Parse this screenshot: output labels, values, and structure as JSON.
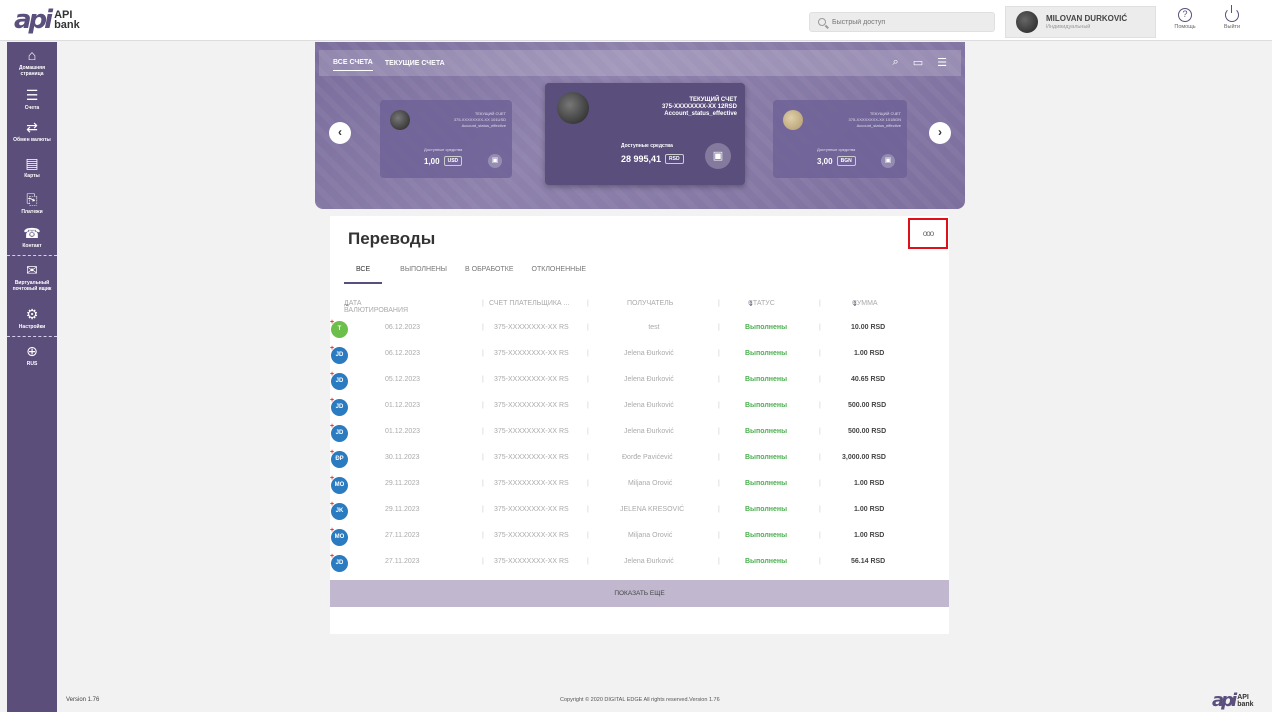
{
  "brand": {
    "mark": "api",
    "line1": "API",
    "line2": "bank"
  },
  "search": {
    "placeholder": "Быстрый доступ"
  },
  "user": {
    "name": "MILOVAN DURKOVIĆ",
    "role": "Индивидуальный"
  },
  "top_actions": {
    "help": "Помощь",
    "logout": "Выйти"
  },
  "sidebar": {
    "items": [
      {
        "icon": "⌂",
        "label": "Домашняя страница"
      },
      {
        "icon": "☰",
        "label": "Счета"
      },
      {
        "icon": "⇄",
        "label": "Обмен валюты"
      },
      {
        "icon": "▤",
        "label": "Карты"
      },
      {
        "icon": "⎘",
        "label": "Платежи"
      },
      {
        "icon": "☎",
        "label": "Контакт"
      },
      {
        "icon": "✉",
        "label": "Виртуальный почтовый ящик"
      },
      {
        "icon": "⚙",
        "label": "Настройки"
      },
      {
        "icon": "⊕",
        "label": "RUS"
      }
    ]
  },
  "carousel": {
    "tabs": [
      "ВСЕ СЧЕТА",
      "ТЕКУЩИЕ СЧЕТА"
    ],
    "cards": [
      {
        "type": "ТЕКУЩИЙ СЧЕТ",
        "account": "375-XXXXXXXX-XX 101USD",
        "status": "Account_status_effective",
        "available": "Доступные средства",
        "amount": "1,00",
        "currency": "USD"
      },
      {
        "type": "ТЕКУЩИЙ СЧЕТ",
        "account": "375-XXXXXXXX-XX 12RSD",
        "status": "Account_status_effective",
        "available": "Доступные средства",
        "amount": "28 995,41",
        "currency": "RSD"
      },
      {
        "type": "ТЕКУЩИЙ СЧЕТ",
        "account": "375-XXXXXXXX-XX 101BGN",
        "status": "Account_status_effective",
        "available": "Доступные средства",
        "amount": "3,00",
        "currency": "BGN"
      }
    ]
  },
  "transfers": {
    "title": "Переводы",
    "more": "ooo",
    "tabs": [
      "ВСЕ",
      "ВЫПОЛНЕНЫ",
      "В ОБРАБОТКЕ",
      "ОТКЛОНЕННЫЕ"
    ],
    "columns": {
      "date": "ДАТА ВАЛЮТИРОВАНИЯ",
      "account": "СЧЕТ ПЛАТЕЛЬЩИКА ...",
      "recipient": "ПОЛУЧАТЕЛЬ",
      "status": "СТАТУС",
      "amount": "СУММА"
    },
    "rows": [
      {
        "initials": "T",
        "date": "06.12.2023",
        "account": "375-XXXXXXXX-XX RS",
        "recipient": "test",
        "status": "Выполнены",
        "amount": "10.00 RSD"
      },
      {
        "initials": "JD",
        "date": "06.12.2023",
        "account": "375-XXXXXXXX-XX RS",
        "recipient": "Jelena Đurković",
        "status": "Выполнены",
        "amount": "1.00 RSD"
      },
      {
        "initials": "JD",
        "date": "05.12.2023",
        "account": "375-XXXXXXXX-XX RS",
        "recipient": "Jelena Đurković",
        "status": "Выполнены",
        "amount": "40.65 RSD"
      },
      {
        "initials": "JD",
        "date": "01.12.2023",
        "account": "375-XXXXXXXX-XX RS",
        "recipient": "Jelena Đurković",
        "status": "Выполнены",
        "amount": "500.00 RSD"
      },
      {
        "initials": "JD",
        "date": "01.12.2023",
        "account": "375-XXXXXXXX-XX RS",
        "recipient": "Jelena Đurković",
        "status": "Выполнены",
        "amount": "500.00 RSD"
      },
      {
        "initials": "ĐP",
        "date": "30.11.2023",
        "account": "375-XXXXXXXX-XX RS",
        "recipient": "Đorđe Pavićević",
        "status": "Выполнены",
        "amount": "3,000.00 RSD"
      },
      {
        "initials": "MO",
        "date": "29.11.2023",
        "account": "375-XXXXXXXX-XX RS",
        "recipient": "Miljana Orović",
        "status": "Выполнены",
        "amount": "1.00 RSD"
      },
      {
        "initials": "JK",
        "date": "29.11.2023",
        "account": "375-XXXXXXXX-XX RS",
        "recipient": "JELENA KRESOVIĆ",
        "status": "Выполнены",
        "amount": "1.00 RSD"
      },
      {
        "initials": "MO",
        "date": "27.11.2023",
        "account": "375-XXXXXXXX-XX RS",
        "recipient": "Miljana Orović",
        "status": "Выполнены",
        "amount": "1.00 RSD"
      },
      {
        "initials": "JD",
        "date": "27.11.2023",
        "account": "375-XXXXXXXX-XX RS",
        "recipient": "Jelena Đurković",
        "status": "Выполнены",
        "amount": "56.14 RSD"
      }
    ],
    "show_more": "ПОКАЗАТЬ ЕЩЕ"
  },
  "footer": {
    "version": "Version 1.76",
    "copyright": "Copyright © 2020 DIGITAL EDGE All rights reserved.Version 1.76"
  }
}
